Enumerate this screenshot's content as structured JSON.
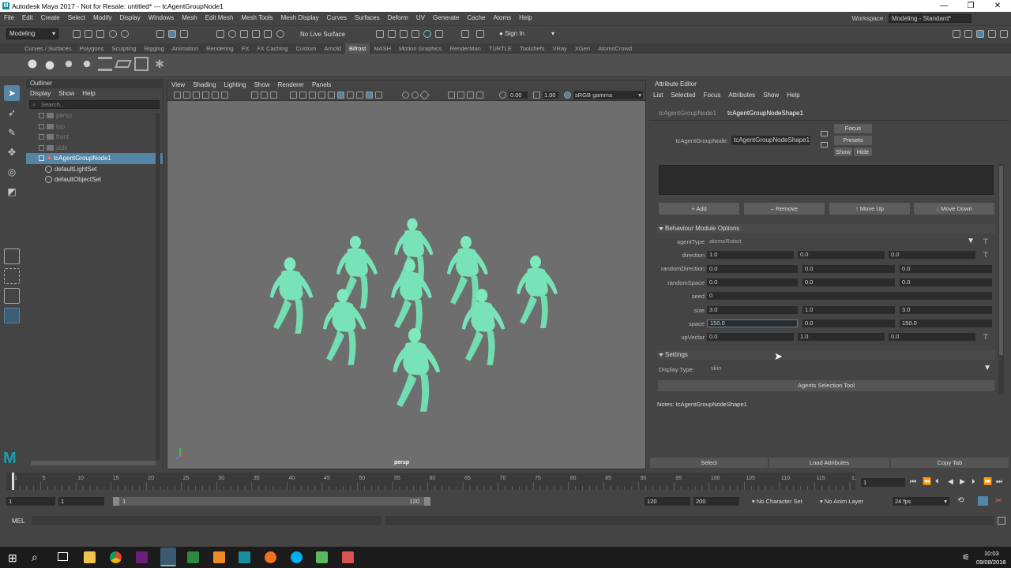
{
  "titlebar": {
    "title": "Autodesk Maya 2017 - Not for Resale: untitled*   ---   tcAgentGroupNode1",
    "minimize": "—",
    "maximize": "❐",
    "close": "✕"
  },
  "menubar": {
    "items": [
      "File",
      "Edit",
      "Create",
      "Select",
      "Modify",
      "Display",
      "Windows",
      "Mesh",
      "Edit Mesh",
      "Mesh Tools",
      "Mesh Display",
      "Curves",
      "Surfaces",
      "Deform",
      "UV",
      "Generate",
      "Cache",
      "Atoms",
      "Help"
    ],
    "workspace_label": "Workspace :",
    "workspace_value": "Modeling - Standard*"
  },
  "statusline": {
    "menuset": "Modeling",
    "live_surface": "No Live Surface",
    "sign_in": "Sign In"
  },
  "shelf": {
    "tabs": [
      "Curves / Surfaces",
      "Polygons",
      "Sculpting",
      "Rigging",
      "Animation",
      "Rendering",
      "FX",
      "FX Caching",
      "Custom",
      "Arnold",
      "Bifrost",
      "MASH",
      "Motion Graphics",
      "RenderMan",
      "TURTLE",
      "Toolchefs",
      "VRay",
      "XGen",
      "AtomsCrowd"
    ],
    "active": "Bifrost"
  },
  "outliner": {
    "title": "Outliner",
    "menu": [
      "Display",
      "Show",
      "Help"
    ],
    "search_placeholder": "Search...",
    "items": [
      {
        "label": "persp"
      },
      {
        "label": "top"
      },
      {
        "label": "front"
      },
      {
        "label": "side"
      },
      {
        "label": "tcAgentGroupNode1"
      },
      {
        "label": "defaultLightSet"
      },
      {
        "label": "defaultObjectSet"
      }
    ]
  },
  "viewport": {
    "menu": [
      "View",
      "Shading",
      "Lighting",
      "Show",
      "Renderer",
      "Panels"
    ],
    "val1": "0.00",
    "val2": "1.00",
    "colorspace": "sRGB gamma",
    "camera": "persp"
  },
  "attr": {
    "title": "Attribute Editor",
    "menu": [
      "List",
      "Selected",
      "Focus",
      "Attributes",
      "Show",
      "Help"
    ],
    "tabs": [
      "tcAgentGroupNode1",
      "tcAgentGroupNodeShape1"
    ],
    "node_label": "tcAgentGroupNode:",
    "node_value": "tcAgentGroupNodeShape1",
    "focus": "Focus",
    "presets": "Presets",
    "show": "Show",
    "hide": "Hide",
    "add": "Add",
    "remove": "Remove",
    "move_up": "Move Up",
    "move_down": "Move Down",
    "behaviour_section": "Behaviour Module Options",
    "agenttype_label": "agentType",
    "agenttype_value": "atomsRobot",
    "direction_label": "direction",
    "direction": [
      "1.0",
      "0.0",
      "0.0"
    ],
    "randomdirection_label": "randomDirection",
    "randomdirection": [
      "0.0",
      "0.0",
      "0.0"
    ],
    "randomspace_label": "randomSpace",
    "randomspace": [
      "0.0",
      "0.0",
      "0.0"
    ],
    "seed_label": "seed",
    "seed": "0",
    "size_label": "size",
    "size": [
      "3.0",
      "1.0",
      "3.0"
    ],
    "space_label": "space",
    "space": [
      "150.0",
      "0.0",
      "150.0"
    ],
    "upvector_label": "upVector",
    "upvector": [
      "0.0",
      "1.0",
      "0.0"
    ],
    "settings_section": "Settings",
    "displaytype_label": "Display Type:",
    "displaytype_value": "skin",
    "agents_tool": "Agents Selection Tool",
    "notes": "Notes:  tcAgentGroupNodeShape1",
    "select": "Select",
    "load_attributes": "Load Attributes",
    "copy_tab": "Copy Tab"
  },
  "timeslider": {
    "ticks": [
      "1",
      "5",
      "10",
      "15",
      "20",
      "25",
      "30",
      "35",
      "40",
      "45",
      "50",
      "55",
      "60",
      "65",
      "70",
      "75",
      "80",
      "85",
      "90",
      "95",
      "100",
      "105",
      "110",
      "115",
      "120"
    ],
    "current": "1"
  },
  "range": {
    "start": "1",
    "start2": "1",
    "slider_start": "1",
    "slider_end": "120",
    "end": "120",
    "end2": "200",
    "char_set": "No Character Set",
    "anim_layer": "No Anim Layer",
    "fps": "24 fps"
  },
  "cmdline": {
    "label": "MEL"
  },
  "taskbar": {
    "time": "10:03",
    "date": "09/08/2018"
  }
}
